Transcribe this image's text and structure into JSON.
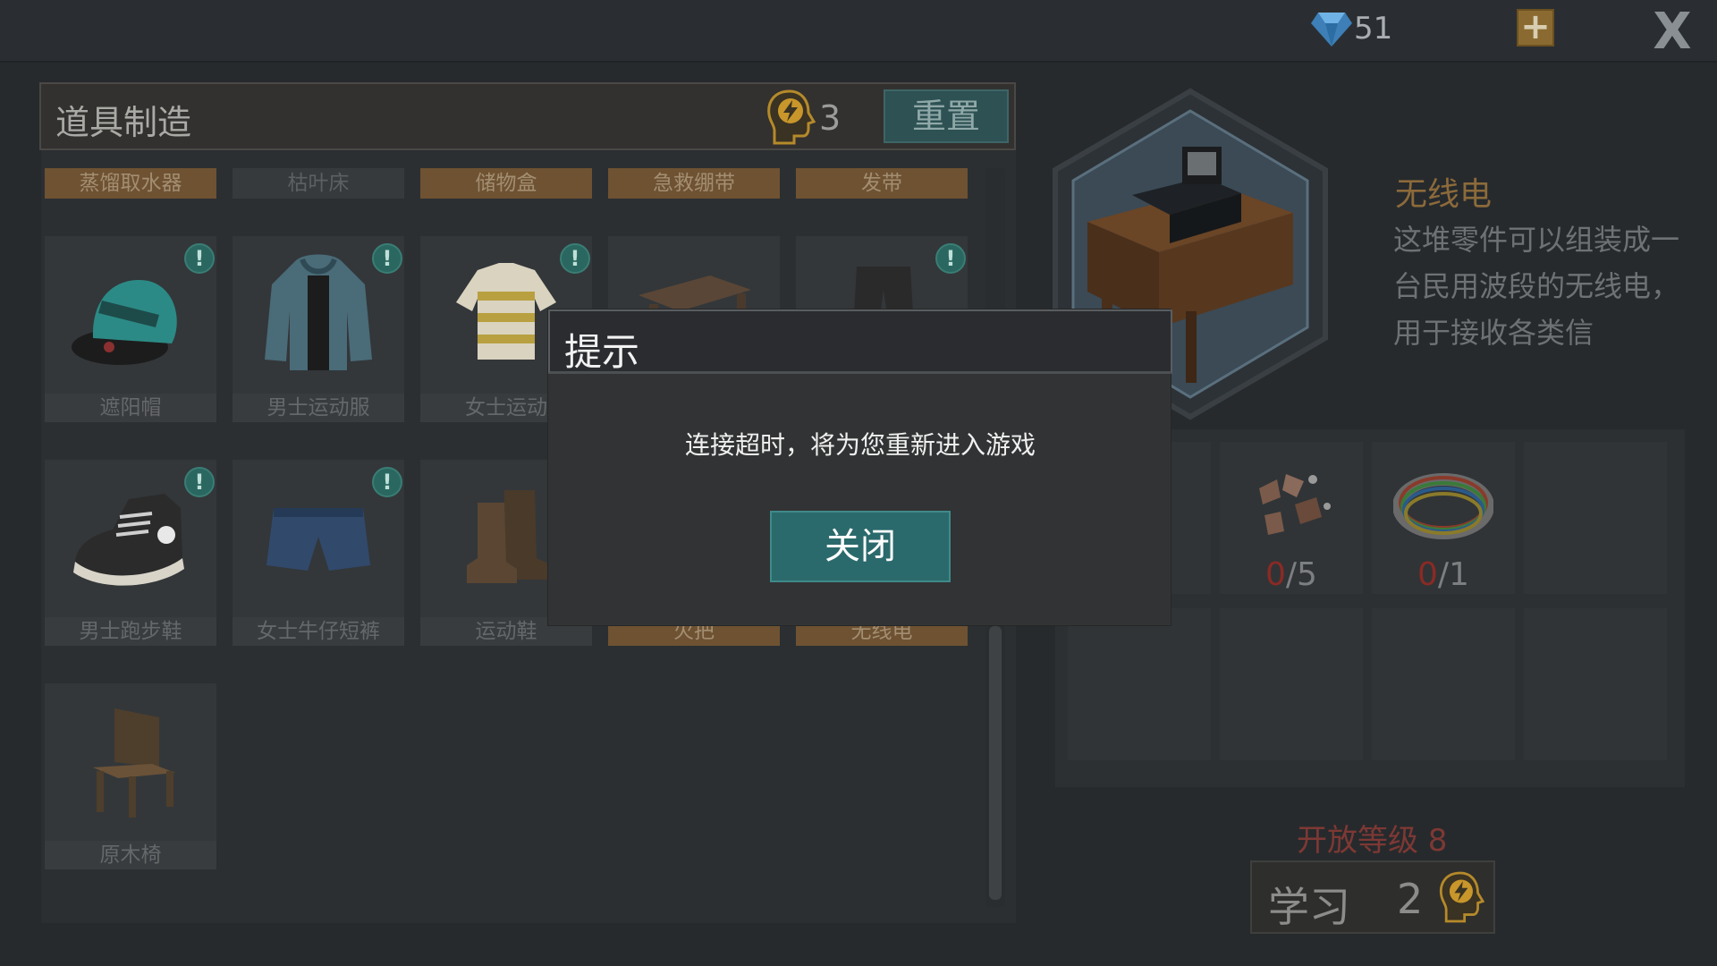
{
  "topbar": {
    "gem_icon": "diamond-icon",
    "gem_count": "51",
    "add_icon": "plus-icon",
    "add_label": "+",
    "close_label": "X"
  },
  "crafting": {
    "title": "道具制造",
    "research_points": "3",
    "reset_label": "重置",
    "tabs": [
      {
        "label": "蒸馏取水器",
        "style": "orange"
      },
      {
        "label": "枯叶床",
        "style": "grey"
      },
      {
        "label": "储物盒",
        "style": "orange"
      },
      {
        "label": "急救绷带",
        "style": "orange"
      },
      {
        "label": "发带",
        "style": "orange"
      }
    ],
    "items": [
      {
        "label": "遮阳帽",
        "icon": "cap-icon",
        "alert": true
      },
      {
        "label": "男士运动服",
        "icon": "hoodie-icon",
        "alert": true
      },
      {
        "label": "女士运动",
        "icon": "striped-shirt-icon",
        "alert": true
      },
      {
        "label": "",
        "icon": "workbench-icon",
        "alert": false
      },
      {
        "label": "",
        "icon": "pants-icon",
        "alert": true
      },
      {
        "label": "男士跑步鞋",
        "icon": "sneaker-icon",
        "alert": true
      },
      {
        "label": "女士牛仔短裤",
        "icon": "shorts-icon",
        "alert": true
      },
      {
        "label": "运动鞋",
        "icon": "boots-icon",
        "alert": false
      },
      {
        "label": "火把",
        "icon": "torch-icon",
        "alert": false
      },
      {
        "label": "无线电",
        "icon": "radio-icon",
        "alert": false
      },
      {
        "label": "原木椅",
        "icon": "chair-icon",
        "alert": false
      }
    ]
  },
  "detail": {
    "name": "无线电",
    "description": "这堆零件可以组装成一台民用波段的无线电，用于接收各类信",
    "materials": [
      {
        "icon": "parts-icon",
        "have": "0",
        "need": "/5"
      },
      {
        "icon": "wire-coil-icon",
        "have": "0",
        "need": "/1"
      }
    ],
    "unlock_text": "开放等级 8",
    "learn_label": "学习",
    "learn_cost": "2"
  },
  "dialog": {
    "title": "提示",
    "message": "连接超时，将为您重新进入游戏",
    "close_label": "关闭"
  }
}
